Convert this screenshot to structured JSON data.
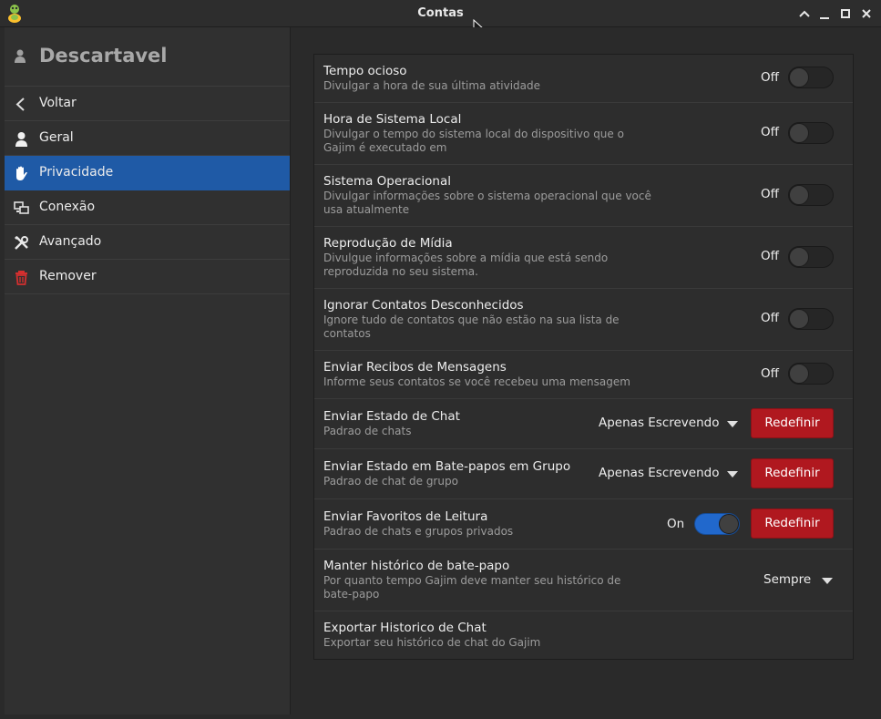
{
  "window": {
    "title": "Contas"
  },
  "sidebar": {
    "account_name": "Descartavel",
    "items": [
      {
        "label": "Voltar",
        "icon": "chevron-left-icon"
      },
      {
        "label": "Geral",
        "icon": "user-icon"
      },
      {
        "label": "Privacidade",
        "icon": "hand-icon",
        "selected": true
      },
      {
        "label": "Conexão",
        "icon": "network-icon"
      },
      {
        "label": "Avançado",
        "icon": "tools-icon"
      },
      {
        "label": "Remover",
        "icon": "trash-icon"
      }
    ]
  },
  "settings": [
    {
      "title": "Tempo ocioso",
      "subtitle": "Divulgar a hora de sua última atividade",
      "control": "switch",
      "state": "Off"
    },
    {
      "title": "Hora de Sistema Local",
      "subtitle": "Divulgar o tempo do sistema local do dispositivo que o Gajim é executado em",
      "control": "switch",
      "state": "Off"
    },
    {
      "title": "Sistema Operacional",
      "subtitle": "Divulgar informações sobre o sistema operacional que você usa atualmente",
      "control": "switch",
      "state": "Off"
    },
    {
      "title": "Reprodução de Mídia",
      "subtitle": "Divulgue informações sobre a mídia que está sendo reproduzida no seu sistema.",
      "control": "switch",
      "state": "Off"
    },
    {
      "title": "Ignorar Contatos Desconhecidos",
      "subtitle": "Ignore tudo de contatos que não estão na sua lista de contatos",
      "control": "switch",
      "state": "Off"
    },
    {
      "title": "Enviar Recibos de Mensagens",
      "subtitle": "Informe seus contatos se você recebeu uma mensagem",
      "control": "switch",
      "state": "Off"
    },
    {
      "title": "Enviar Estado de Chat",
      "subtitle": "Padrao de chats",
      "control": "dropdown",
      "value": "Apenas Escrevendo",
      "button": "Redefinir"
    },
    {
      "title": "Enviar Estado em Bate-papos em Grupo",
      "subtitle": "Padrao de chat de grupo",
      "control": "dropdown",
      "value": "Apenas Escrevendo",
      "button": "Redefinir"
    },
    {
      "title": "Enviar Favoritos de Leitura",
      "subtitle": "Padrao de chats e grupos privados",
      "control": "switch",
      "state": "On",
      "button": "Redefinir"
    },
    {
      "title": "Manter histórico de bate-papo",
      "subtitle": "Por quanto tempo Gajim deve manter seu histórico de bate-papo",
      "control": "dropdown",
      "value": "Sempre"
    },
    {
      "title": "Exportar Historico de Chat",
      "subtitle": "Exportar seu histórico de chat do Gajim",
      "control": "none"
    }
  ],
  "colors": {
    "accent": "#1f5aa6",
    "switch_on": "#2168cc",
    "danger": "#b0181f"
  }
}
